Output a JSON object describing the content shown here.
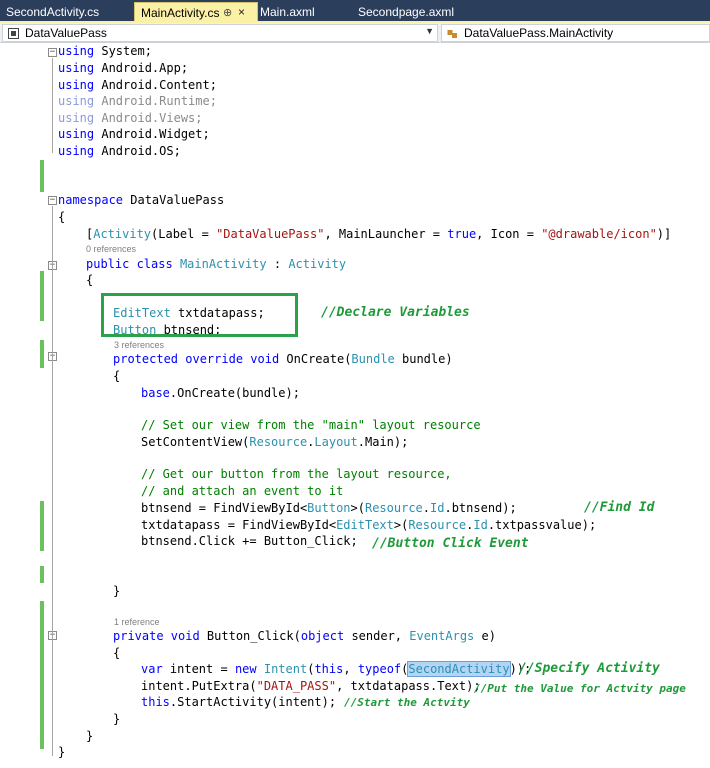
{
  "tabs": [
    {
      "label": "SecondActivity.cs",
      "active": false
    },
    {
      "label": "MainActivity.cs",
      "active": true
    },
    {
      "label": "Main.axml",
      "active": false
    },
    {
      "label": "Secondpage.axml",
      "active": false
    }
  ],
  "tab_pin_glyph": "⊕",
  "tab_close_glyph": "×",
  "nav": {
    "left": "DataValuePass",
    "right": "DataValuePass.MainActivity"
  },
  "codelens": {
    "zero": "0 references",
    "three": "3 references",
    "one": "1 reference"
  },
  "annotations": {
    "declare": "//Declare Variables",
    "find": "//Find Id",
    "click": "//Button Click Event",
    "specify": "//Specify Activity",
    "put": "//Put the Value for Actvity page",
    "start": "//Start the Actvity"
  },
  "code": {
    "u1": "using System;",
    "u2": "using Android.App;",
    "u3": "using Android.Content;",
    "u4": "using Android.Runtime;",
    "u5": "using Android.Views;",
    "u6": "using Android.Widget;",
    "u7": "using Android.OS;",
    "ns": "namespace DataValuePass",
    "attr": "[Activity(Label = \"DataValuePass\", MainLauncher = true, Icon = \"@drawable/icon\")]",
    "cls": "public class MainActivity : Activity",
    "edt": "EditText txtdatapass;",
    "btn": "Button btnsend;",
    "oncreate": "protected override void OnCreate(Bundle bundle)",
    "base": "base.OnCreate(bundle);",
    "c1": "// Set our view from the \"main\" layout resource",
    "setcv": "SetContentView(Resource.Layout.Main);",
    "c2": "// Get our button from the layout resource,",
    "c3": "// and attach an event to it",
    "fb1": "btnsend = FindViewById<Button>(Resource.Id.btnsend);",
    "fb2": "txtdatapass = FindViewById<EditText>(Resource.Id.txtpassvalue);",
    "click": "btnsend.Click += Button_Click;",
    "priv": "private void Button_Click(object sender, EventArgs e)",
    "intent": "var intent = new Intent(this, typeof(SecondActivity));",
    "putextra": "intent.PutExtra(\"DATA_PASS\", txtdatapass.Text);",
    "start": "this.StartActivity(intent);",
    "ob": "{",
    "cb": "}"
  }
}
